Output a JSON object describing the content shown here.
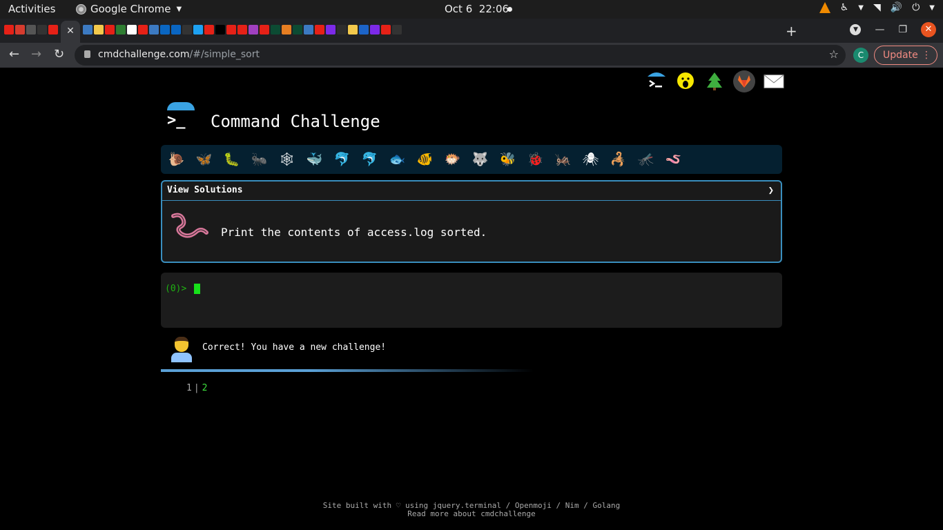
{
  "gnome": {
    "activities": "Activities",
    "app_name": "Google Chrome",
    "date": "Oct 6",
    "time": "22:06"
  },
  "browser": {
    "url_host": "cmdchallenge.com",
    "url_path": "/#/simple_sort",
    "profile_initial": "C",
    "update_label": "Update",
    "tab_favicon_colors": [
      "#e62117",
      "#d63b2e",
      "#555",
      "#333",
      "#e62117",
      "#3c7ac2",
      "#f2c94c",
      "#e62117",
      "#2e7d32",
      "#fff",
      "#e62117",
      "#3c7ac2",
      "#0a66c2",
      "#0a66c2",
      "#333",
      "#1da1f2",
      "#e62117",
      "#000",
      "#e62117",
      "#e62117",
      "#a040c0",
      "#e62117",
      "#0c4b33",
      "#e67e22",
      "#0c4b33",
      "#3c7ac2",
      "#e62117",
      "#7c2ae8",
      "#2d2d2d",
      "#f2c94c",
      "#1c64c8",
      "#7c2ae8",
      "#e62117",
      "#333"
    ]
  },
  "page": {
    "title": "Command Challenge",
    "critters": [
      "🐌",
      "🦋",
      "🐛",
      "🐜",
      "🕸",
      "🐳",
      "🐬",
      "🐬",
      "🐟",
      "🐠",
      "🐡",
      "🐺",
      "🐝",
      "🐞",
      "🦗",
      "🕷",
      "🦂",
      "🦟",
      "🪱"
    ],
    "solutions": {
      "label": "View Solutions",
      "caret": "❯",
      "challenge_text": "Print the contents of access.log sorted."
    },
    "terminal": {
      "prompt": "(0)>"
    },
    "feedback": "Correct! You have a new challenge!",
    "progress_fraction": 0.4,
    "output": {
      "line_number": "1",
      "value": "2"
    },
    "footer": {
      "line1": "Site built with ♡ using jquery.terminal / Openmoji / Nim / Golang",
      "line2": "Read more about cmdchallenge"
    }
  }
}
